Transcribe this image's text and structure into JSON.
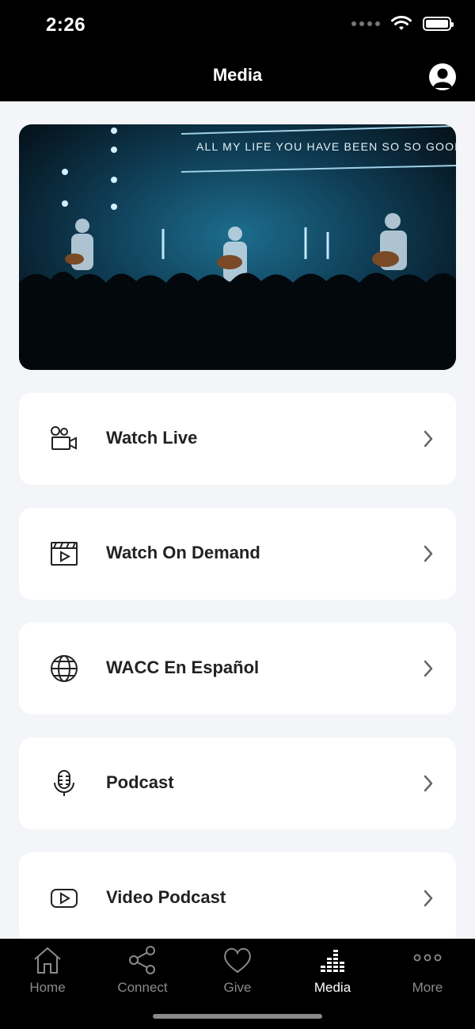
{
  "status_bar": {
    "time": "2:26"
  },
  "nav": {
    "title": "Media",
    "profile_icon": "person-circle-icon"
  },
  "hero": {
    "lyric_text": "ALL MY LIFE YOU HAVE BEEN SO SO GOOD"
  },
  "menu": {
    "items": [
      {
        "label": "Watch Live",
        "icon": "video-camera-icon"
      },
      {
        "label": "Watch On Demand",
        "icon": "clapperboard-icon"
      },
      {
        "label": "WACC En Español",
        "icon": "globe-icon"
      },
      {
        "label": "Podcast",
        "icon": "microphone-icon"
      },
      {
        "label": "Video Podcast",
        "icon": "youtube-icon"
      }
    ]
  },
  "tab_bar": {
    "tabs": [
      {
        "label": "Home",
        "icon": "home-icon"
      },
      {
        "label": "Connect",
        "icon": "share-icon"
      },
      {
        "label": "Give",
        "icon": "heart-icon"
      },
      {
        "label": "Media",
        "icon": "equalizer-icon",
        "active": true
      },
      {
        "label": "More",
        "icon": "more-dots-icon"
      }
    ]
  },
  "colors": {
    "bar_background": "#000000",
    "page_background": "#f4f5f9",
    "card_background": "#ffffff",
    "inactive_tab": "#8a8a8a",
    "active_tab": "#ffffff"
  }
}
